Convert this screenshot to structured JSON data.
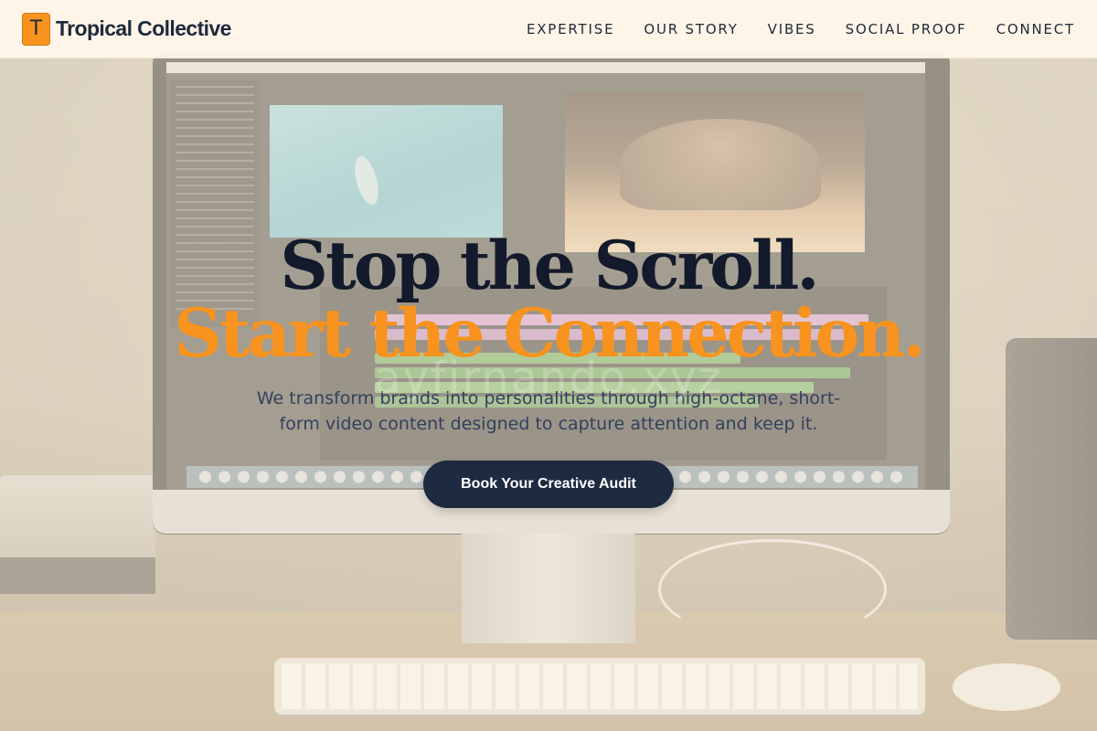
{
  "brand": {
    "logo_letter": "T",
    "name": "Tropical Collective",
    "accent_color": "#f7931e"
  },
  "nav": {
    "items": [
      {
        "label": "EXPERTISE"
      },
      {
        "label": "OUR STORY"
      },
      {
        "label": "VIBES"
      },
      {
        "label": "SOCIAL PROOF"
      },
      {
        "label": "CONNECT"
      }
    ]
  },
  "hero": {
    "title_line1": "Stop the Scroll.",
    "title_line2": "Start the Connection.",
    "watermark": "ayfirnando.xyz",
    "subtitle": "We transform brands into personalities through high-octane, short-form video content designed to capture attention and keep it.",
    "cta_label": "Book Your Creative Audit",
    "title_color": "#121a2b",
    "cta_color": "#1e2a40"
  }
}
